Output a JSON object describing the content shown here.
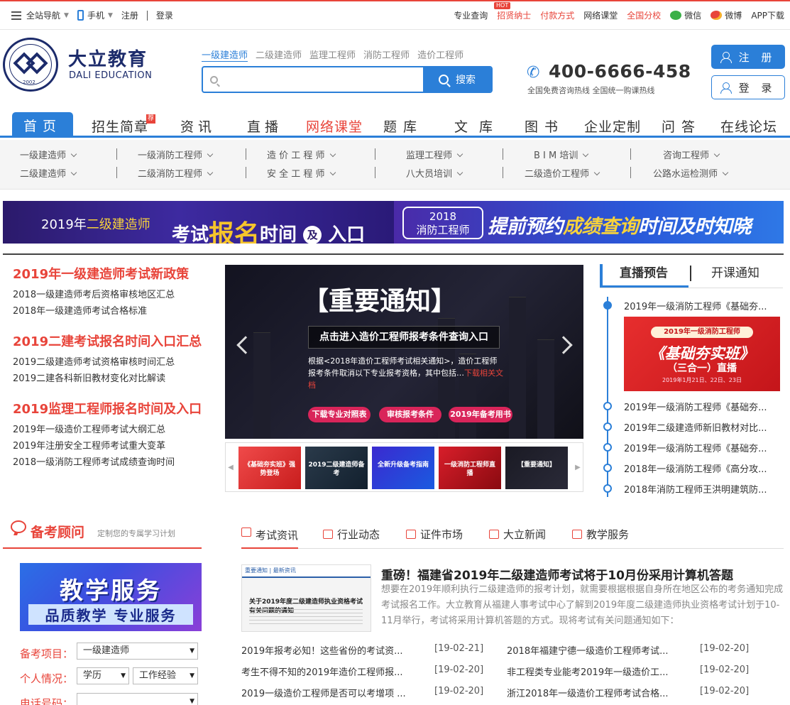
{
  "topbar": {
    "nav_label": "全站导航",
    "mobile_label": "手机",
    "register": "注册",
    "login": "登录",
    "right_links": [
      "专业查询",
      "招贤纳士",
      "付款方式",
      "网络课堂",
      "全国分校",
      "微信",
      "微博",
      "APP下载"
    ],
    "hot_badge": "HOT"
  },
  "header": {
    "brand_cn": "大立教育",
    "brand_en": "DALI EDUCATION",
    "logo_year": "2002",
    "search_categories": [
      "一级建造师",
      "二级建造师",
      "监理工程师",
      "消防工程师",
      "造价工程师"
    ],
    "search_placeholder": "",
    "search_button": "搜索",
    "hotline": "400-6666-458",
    "hotline_sub": "全国免费咨询热线 全国统一购课热线",
    "register_button": "注 册",
    "login_button": "登 录"
  },
  "mainnav": {
    "items": [
      "首页",
      "招生简章",
      "资讯",
      "直播",
      "网络课堂",
      "题库",
      "文库",
      "图书",
      "企业定制",
      "问答",
      "在线论坛"
    ],
    "tag": "荐"
  },
  "subnav": {
    "row1": [
      "一级建造师",
      "一级消防工程师",
      "造 价 工 程 师",
      "监理工程师",
      "B I M 培训",
      "咨询工程师"
    ],
    "row2": [
      "二级建造师",
      "二级消防工程师",
      "安 全 工 程 师",
      "八大员培训",
      "二级造价工程师",
      "公路水运检测师"
    ]
  },
  "banners": {
    "left_year": "2019年",
    "left_exam": "二级建造师",
    "left_a": "考试",
    "left_b": "报名",
    "left_c": "时间",
    "left_circle": "及",
    "left_d": "入口",
    "right_box1": "2018",
    "right_box2": "消防工程师",
    "right_a": "提前预约",
    "right_b": "成绩查询",
    "right_c": "时间及时知晓"
  },
  "news_left": [
    {
      "title": "2019年一级建造师考试新政策",
      "items": [
        "2018一级建造师考后资格审核地区汇总",
        "2018年一级建造师考试合格标准"
      ]
    },
    {
      "title": "2019二建考试报名时间入口汇总",
      "items": [
        "2019二级建造师考试资格审核时间汇总",
        "2019二建各科新旧教材变化对比解读"
      ]
    },
    {
      "title": "2019监理工程师报名时间及入口",
      "items": [
        "2019年一级造价工程师考试大纲汇总",
        "2019年注册安全工程师考试重大变革",
        "2018一级消防工程师考试成绩查询时间"
      ]
    }
  ],
  "carousel": {
    "title": "【重要通知】",
    "box": "点击进入造价工程师报考条件查询入口",
    "text": "根据<2018年造价工程师考试相关通知>，造价工程师报考条件取消以下专业报考资格，其中包括…",
    "text_link": "下载相关文档",
    "pills": [
      "下载专业对照表",
      "审核报考条件",
      "2019年备考用书"
    ],
    "thumbs": [
      "《基础夯实班》强势登场",
      "2019二级建造师备考",
      "全新升级备考指南",
      "一级消防工程师直播",
      "【重要通知】"
    ]
  },
  "live": {
    "tab_active": "直播预告",
    "tab_other": "开课通知",
    "first": "2019年一级消防工程师《基础夯...",
    "card_top": "2019年一级消防工程师",
    "card_main": "《基础夯实班》",
    "card_sub": "（三合一）直播",
    "card_date": "2019年1月21日、22日、23日",
    "items": [
      "2019年一级消防工程师《基础夯...",
      "2019年二级建造师新旧教材对比...",
      "2019年一级消防工程师《基础夯...",
      "2018年一级消防工程师《高分攻...",
      "2018年消防工程师王洪明建筑防..."
    ]
  },
  "advisor": {
    "title": "备考顾问",
    "subtitle": "定制您的专属学习计划",
    "banner_a": "教学服务",
    "banner_b": "品质教学 专业服务",
    "project_label": "备考项目：",
    "project_value": "一级建造师",
    "personal_label": "个人情况：",
    "edu_value": "学历",
    "exp_value": "工作经验",
    "phone_label": "电话号码："
  },
  "news_tabs": [
    "考试资讯",
    "行业动态",
    "证件市场",
    "大立新闻",
    "教学服务"
  ],
  "headline": {
    "img_header": "重要通知 | 最新资讯",
    "img_text": "关于2019年度二级建造师执业资格考试有关问题的通知",
    "title": "重磅！福建省2019年二级建造师考试将于10月份采用计算机答题",
    "text": "想要在2019年顺利执行二级建造师的报考计划，就需要根据根据自身所在地区公布的考务通知完成考试报名工作。大立教育从福建人事考试中心了解到2019年度二级建造师执业资格考试计划于10-11月举行，考试将采用计算机答题的方式。现将考试有关问题通知如下："
  },
  "news_list": [
    {
      "title": "2019年报考必知！这些省份的考试资...",
      "date": "[19-02-21]"
    },
    {
      "title": "2018年福建宁德一级造价工程师考试...",
      "date": "[19-02-20]"
    },
    {
      "title": "考生不得不知的2019年造价工程师报...",
      "date": "[19-02-20]"
    },
    {
      "title": "非工程类专业能考2019年一级造价工...",
      "date": "[19-02-20]"
    },
    {
      "title": "2019一级造价工程师是否可以考增项 ...",
      "date": "[19-02-20]"
    },
    {
      "title": "浙江2018年一级造价工程师考试合格...",
      "date": "[19-02-20]"
    }
  ],
  "colors": {
    "accent": "#2b7fd8",
    "red": "#e8443a",
    "brand": "#1c2b6b"
  }
}
